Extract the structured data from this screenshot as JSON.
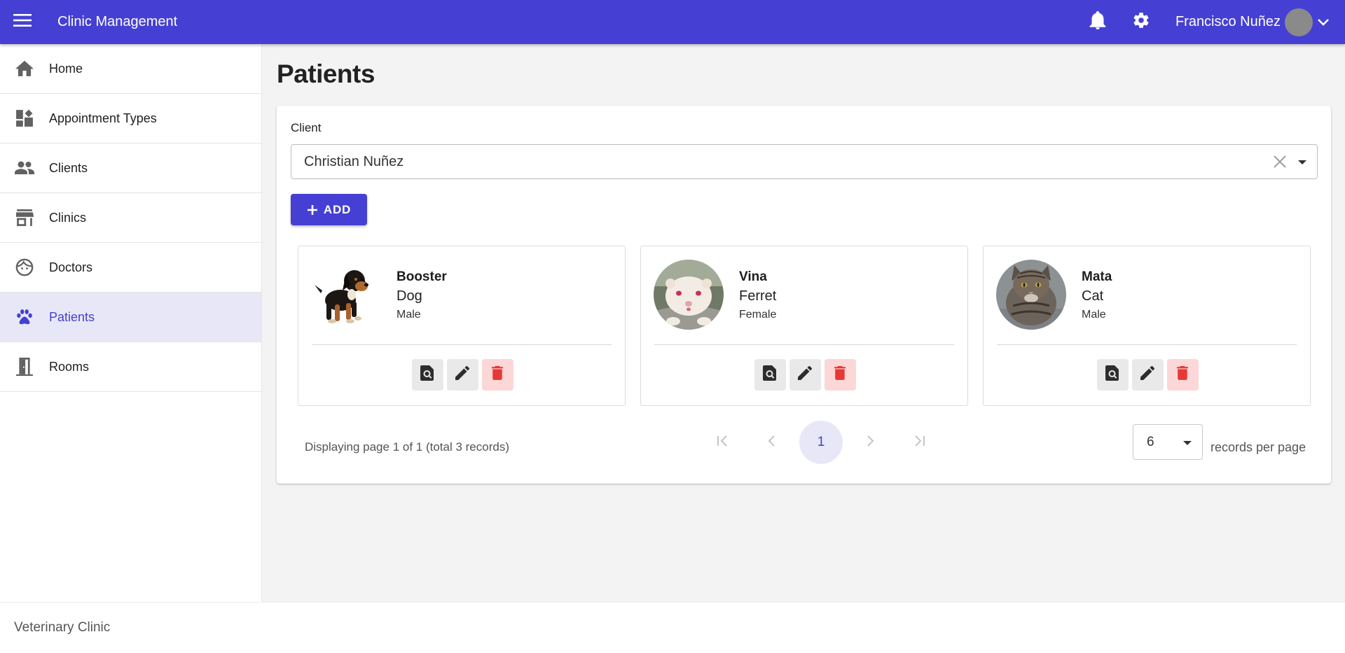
{
  "app": {
    "title": "Clinic Management",
    "footer": "Veterinary Clinic"
  },
  "user": {
    "name": "Francisco Nuñez"
  },
  "colors": {
    "primary": "#4540d3",
    "active_bg": "#e8e7f8",
    "danger": "#e53935",
    "danger_bg": "#fcd7d7"
  },
  "sidebar": {
    "items": [
      {
        "label": "Home",
        "icon": "home-icon"
      },
      {
        "label": "Appointment Types",
        "icon": "dashboard-icon"
      },
      {
        "label": "Clients",
        "icon": "people-icon"
      },
      {
        "label": "Clinics",
        "icon": "store-icon"
      },
      {
        "label": "Doctors",
        "icon": "face-icon"
      },
      {
        "label": "Patients",
        "icon": "paw-icon",
        "active": true
      },
      {
        "label": "Rooms",
        "icon": "door-icon"
      }
    ]
  },
  "page": {
    "title": "Patients"
  },
  "filter": {
    "label": "Client",
    "value": "Christian Nuñez"
  },
  "add_button": {
    "label": "ADD"
  },
  "patients": [
    {
      "name": "Booster",
      "species": "Dog",
      "sex": "Male"
    },
    {
      "name": "Vina",
      "species": "Ferret",
      "sex": "Female"
    },
    {
      "name": "Mata",
      "species": "Cat",
      "sex": "Male"
    }
  ],
  "pagination": {
    "info": "Displaying page 1 of 1 (total 3 records)",
    "current_page": "1",
    "records_per_page": "6",
    "records_per_page_label": "records per page"
  }
}
